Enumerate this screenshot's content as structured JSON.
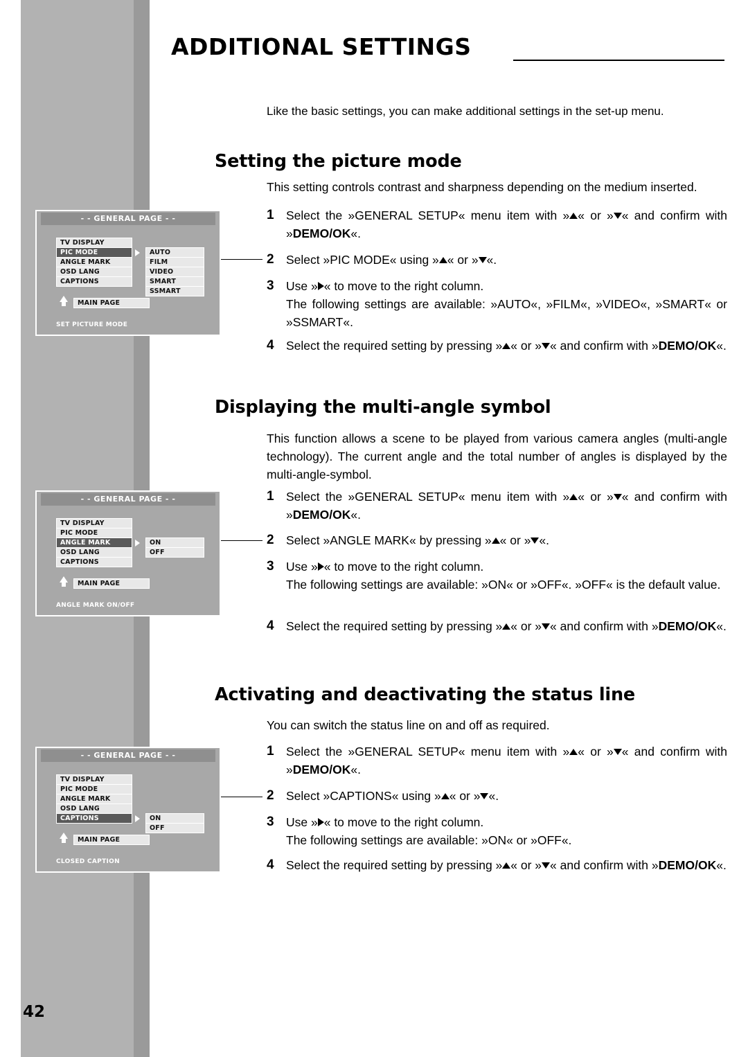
{
  "page": {
    "title": "ADDITIONAL SETTINGS",
    "number": "42",
    "intro": "Like the basic settings, you can make additional settings in the set-up menu."
  },
  "sections": [
    {
      "heading": "Setting the picture mode",
      "subtitle": "This setting controls contrast and sharpness depending on the medium inserted.",
      "steps": [
        {
          "num": "1",
          "text_a": "Select the »GENERAL SETUP« menu item with »",
          "text_b": "« or »",
          "text_c": "« and confirm with »",
          "bold": "DEMO/OK",
          "text_d": "«."
        },
        {
          "num": "2",
          "text_a": "Select »PIC MODE« using »",
          "text_b": "« or »",
          "text_c": "«."
        },
        {
          "num": "3",
          "text_a": "Use »",
          "text_b": "« to move to the right column.",
          "text_c": "The following settings are available: »AUTO«, »FILM«, »VIDEO«, »SMART« or »SSMART«."
        },
        {
          "num": "4",
          "text_a": "Select the required setting by pressing »",
          "text_b": "« or »",
          "text_c": "« and confirm with »",
          "bold": "DEMO/OK",
          "text_d": "«."
        }
      ]
    },
    {
      "heading": "Displaying the multi-angle symbol",
      "subtitle": "This function allows a scene to be played from various camera angles (multi-angle technology). The current angle and the total number of angles is displayed by the multi-angle-symbol.",
      "steps": [
        {
          "num": "1",
          "text_a": "Select the »GENERAL SETUP« menu item with »",
          "text_b": "« or »",
          "text_c": "« and confirm with »",
          "bold": "DEMO/OK",
          "text_d": "«."
        },
        {
          "num": "2",
          "text_a": "Select »ANGLE MARK« by pressing »",
          "text_b": "« or »",
          "text_c": "«."
        },
        {
          "num": "3",
          "text_a": "Use »",
          "text_b": "« to move to the right column.",
          "text_c": "The following settings are available: »ON« or »OFF«. »OFF« is the default value."
        },
        {
          "num": "4",
          "text_a": "Select the required setting by pressing »",
          "text_b": "« or »",
          "text_c": "« and confirm with »",
          "bold": "DEMO/OK",
          "text_d": "«."
        }
      ]
    },
    {
      "heading": "Activating and deactivating the status line",
      "subtitle": "You can switch the status line on and off as required.",
      "steps": [
        {
          "num": "1",
          "text_a": "Select the »GENERAL SETUP« menu item with »",
          "text_b": "« or »",
          "text_c": "« and confirm with »",
          "bold": "DEMO/OK",
          "text_d": "«."
        },
        {
          "num": "2",
          "text_a": "Select »CAPTIONS« using »",
          "text_b": "« or »",
          "text_c": "«."
        },
        {
          "num": "3",
          "text_a": "Use »",
          "text_b": "« to move to the right column.",
          "text_c": "The following settings are available: »ON« or »OFF«."
        },
        {
          "num": "4",
          "text_a": "Select the required setting by pressing »",
          "text_b": "« or »",
          "text_c": "« and confirm with »",
          "bold": "DEMO/OK",
          "text_d": "«."
        }
      ]
    }
  ],
  "osd": [
    {
      "title": "- - GENERAL PAGE - -",
      "left_items": [
        "TV DISPLAY",
        "PIC MODE",
        "ANGLE MARK",
        "OSD LANG",
        "CAPTIONS"
      ],
      "selected_left": "PIC MODE",
      "right_items": [
        "AUTO",
        "FILM",
        "VIDEO",
        "SMART",
        "SSMART"
      ],
      "main_page": "MAIN PAGE",
      "footer": "SET PICTURE MODE"
    },
    {
      "title": "- - GENERAL PAGE - -",
      "left_items": [
        "TV DISPLAY",
        "PIC MODE",
        "ANGLE MARK",
        "OSD LANG",
        "CAPTIONS"
      ],
      "selected_left": "ANGLE MARK",
      "right_items": [
        "ON",
        "OFF"
      ],
      "main_page": "MAIN PAGE",
      "footer": "ANGLE MARK ON/OFF"
    },
    {
      "title": "- - GENERAL PAGE - -",
      "left_items": [
        "TV DISPLAY",
        "PIC MODE",
        "ANGLE MARK",
        "OSD LANG",
        "CAPTIONS"
      ],
      "selected_left": "CAPTIONS",
      "right_items": [
        "ON",
        "OFF"
      ],
      "main_page": "MAIN PAGE",
      "footer": "CLOSED CAPTION"
    }
  ]
}
